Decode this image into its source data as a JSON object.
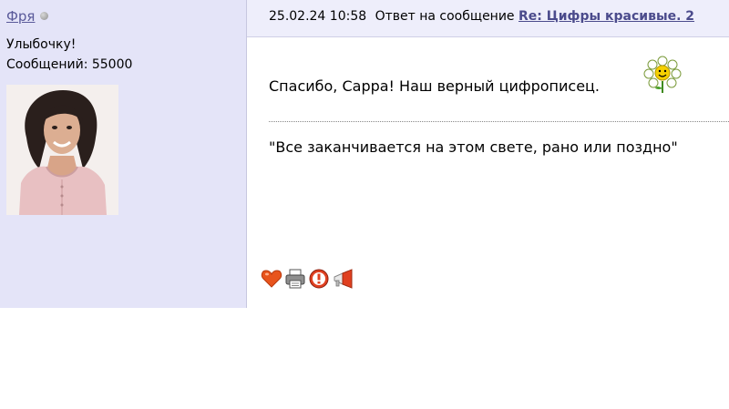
{
  "author": {
    "name": "Фря",
    "motto": "Улыбочку!",
    "posts_label": "Сообщений: 55000"
  },
  "post": {
    "date": "25.02.24 10:58",
    "reply_prefix": "Ответ на сообщение",
    "thread_title": "Re: Цифры красивые. 2",
    "body": "Спасибо, Сарра! Наш верный цифрописец.",
    "signature": "\"Все заканчивается на этом свете, рано или поздно\""
  },
  "actions": {
    "items": [
      {
        "icon": "heart-icon"
      },
      {
        "icon": "printer-icon"
      },
      {
        "icon": "warning-icon"
      },
      {
        "icon": "megaphone-icon"
      }
    ]
  },
  "colors": {
    "sidebar_bg": "#e4e4f8",
    "header_bg": "#eeeefb",
    "link": "#4b4b8c"
  }
}
